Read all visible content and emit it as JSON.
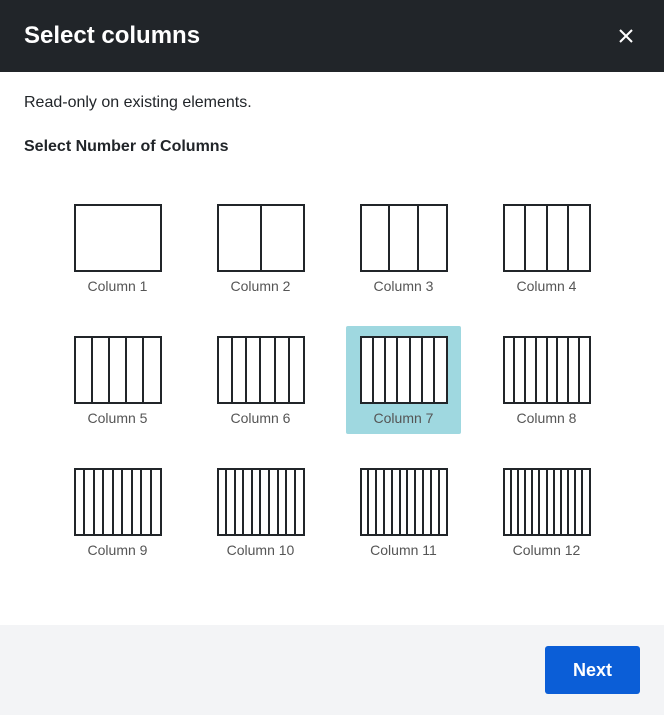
{
  "header": {
    "title": "Select columns"
  },
  "body": {
    "readonly_text": "Read-only on existing elements.",
    "section_label": "Select Number of Columns"
  },
  "options": [
    {
      "cols": 1,
      "label": "Column 1",
      "selected": false
    },
    {
      "cols": 2,
      "label": "Column 2",
      "selected": false
    },
    {
      "cols": 3,
      "label": "Column 3",
      "selected": false
    },
    {
      "cols": 4,
      "label": "Column 4",
      "selected": false
    },
    {
      "cols": 5,
      "label": "Column 5",
      "selected": false
    },
    {
      "cols": 6,
      "label": "Column 6",
      "selected": false
    },
    {
      "cols": 7,
      "label": "Column 7",
      "selected": true
    },
    {
      "cols": 8,
      "label": "Column 8",
      "selected": false
    },
    {
      "cols": 9,
      "label": "Column 9",
      "selected": false
    },
    {
      "cols": 10,
      "label": "Column 10",
      "selected": false
    },
    {
      "cols": 11,
      "label": "Column 11",
      "selected": false
    },
    {
      "cols": 12,
      "label": "Column 12",
      "selected": false
    }
  ],
  "footer": {
    "next_label": "Next"
  },
  "colors": {
    "header_bg": "#212529",
    "selected_bg": "#9fd8e0",
    "primary_btn": "#0b5ed7"
  }
}
